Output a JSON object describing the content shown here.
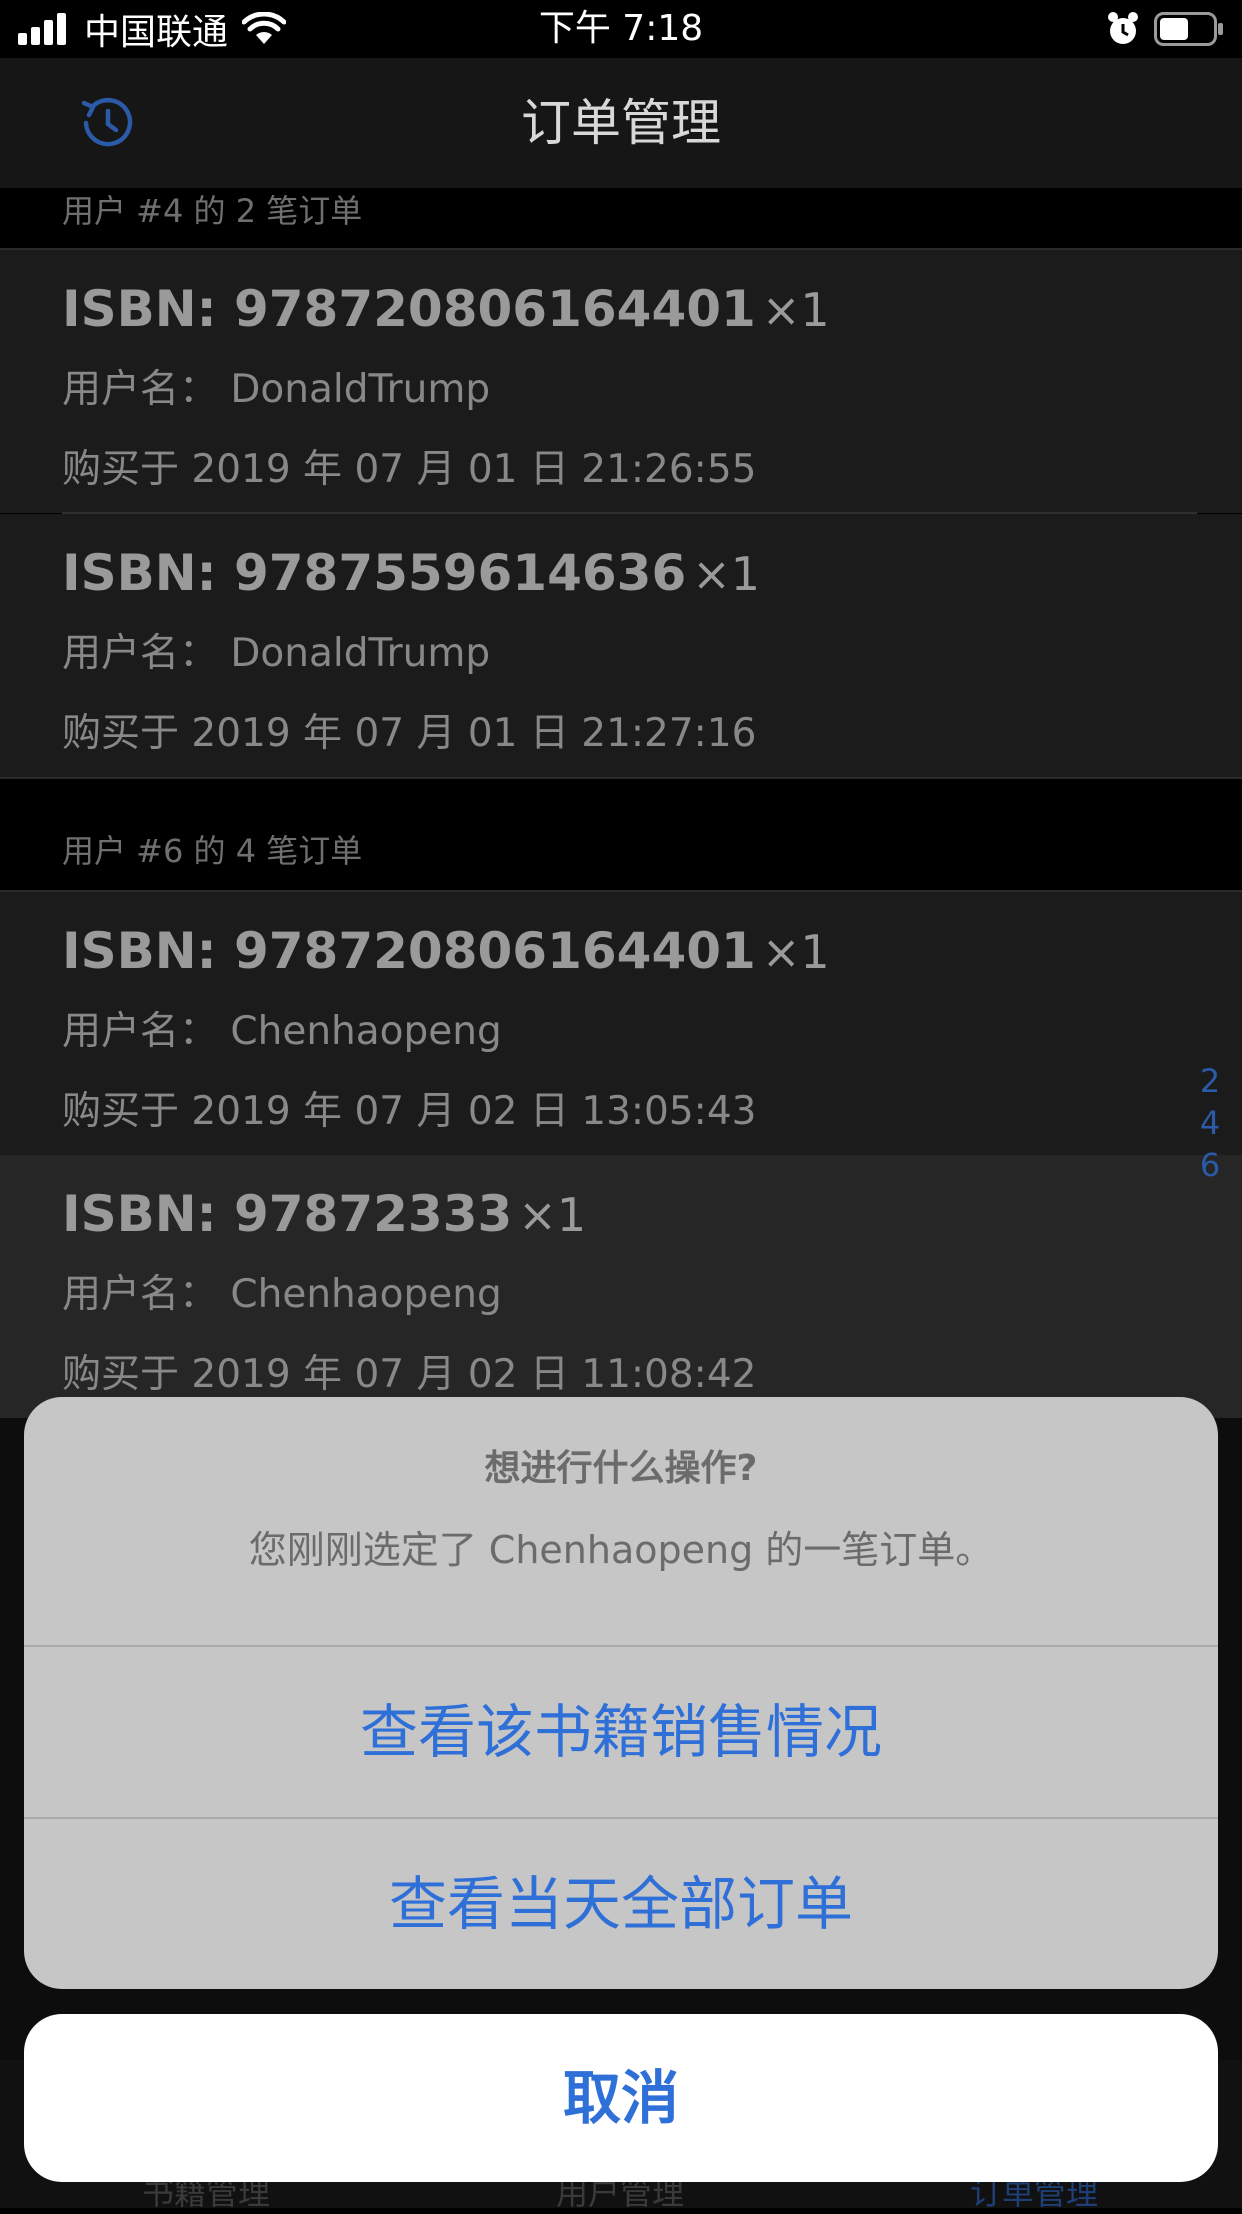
{
  "status_bar": {
    "carrier": "中国联通",
    "time": "下午 7:18"
  },
  "nav": {
    "title": "订单管理",
    "left_icon": "history-icon"
  },
  "sections": [
    {
      "header": "用户 #4 的 2 笔订单",
      "orders": [
        {
          "isbn": "ISBN: 978720806164401",
          "qty": "×1",
          "user": "用户名： DonaldTrump",
          "date": "购买于 2019 年 07 月 01 日 21:26:55"
        },
        {
          "isbn": "ISBN: 9787559614636",
          "qty": "×1",
          "user": "用户名： DonaldTrump",
          "date": "购买于 2019 年 07 月 01 日 21:27:16"
        }
      ]
    },
    {
      "header": "用户 #6 的 4 笔订单",
      "orders": [
        {
          "isbn": "ISBN: 978720806164401",
          "qty": "×1",
          "user": "用户名： Chenhaopeng",
          "date": "购买于 2019 年 07 月 02 日 13:05:43"
        },
        {
          "isbn": "ISBN: 97872333",
          "qty": "×1",
          "user": "用户名： Chenhaopeng",
          "date": "购买于 2019 年 07 月 02 日 11:08:42"
        }
      ]
    }
  ],
  "index": [
    "2",
    "4",
    "6"
  ],
  "tabs": [
    "书籍管理",
    "用户管理",
    "订单管理"
  ],
  "action_sheet": {
    "title": "想进行什么操作?",
    "message": "您刚刚选定了 Chenhaopeng 的一笔订单。",
    "actions": [
      "查看该书籍销售情况",
      "查看当天全部订单"
    ],
    "cancel": "取消"
  },
  "colors": {
    "accent": "#2f6fd8",
    "background": "#000000",
    "row": "#1b1b1b",
    "sheet": "#c6c6c6"
  }
}
